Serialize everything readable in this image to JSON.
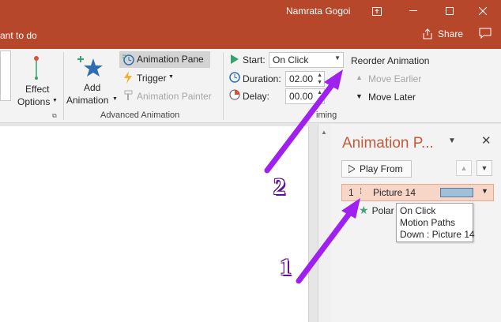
{
  "titlebar": {
    "user_name": "Namrata Gogoi",
    "ribbon_display_icon": "ribbon-display-icon",
    "minimize_icon": "minimize-icon",
    "maximize_icon": "maximize-icon",
    "close_icon": "close-icon",
    "color": "#b7472a"
  },
  "tellbar": {
    "tell_me_text": "ant to do",
    "share_label": "Share",
    "share_icon": "share-icon",
    "comment_icon": "comment-icon"
  },
  "ribbon": {
    "effect_options": {
      "line1": "Effect",
      "line2": "Options"
    },
    "add_animation": {
      "line1": "Add",
      "line2": "Animation"
    },
    "animation_pane_label": "Animation Pane",
    "trigger_label": "Trigger",
    "animation_painter_label": "Animation Painter",
    "advanced_animation_group": "Advanced Animation",
    "start_label": "Start:",
    "start_value": "On Click",
    "duration_label": "Duration:",
    "duration_value": "02.00",
    "delay_label": "Delay:",
    "delay_value": "00.00",
    "timing_group": "iming",
    "reorder_label": "Reorder Animation",
    "move_earlier_label": "Move Earlier",
    "move_later_label": "Move Later"
  },
  "animation_pane": {
    "title": "Animation P...",
    "play_from_label": "Play From",
    "items": [
      {
        "index": "1",
        "name": "Picture 14",
        "color": "#9ec1d9"
      },
      {
        "index": "",
        "name": "Polar"
      }
    ],
    "tooltip": {
      "line1": "On Click",
      "line2": "Motion Paths",
      "line3": "Down : Picture 14"
    }
  },
  "annotations": {
    "marker_1": "1",
    "marker_2": "2",
    "arrow_color": "#a020f0"
  }
}
